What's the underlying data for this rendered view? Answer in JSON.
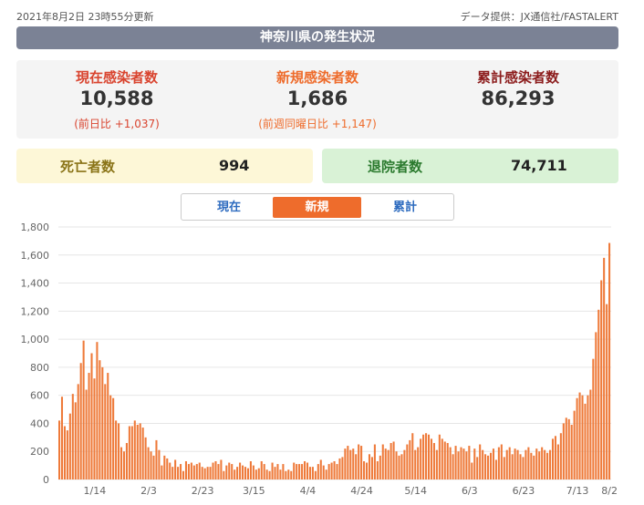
{
  "header": {
    "updated": "2021年8月2日 23時55分更新",
    "source": "データ提供：JX通信社/FASTALERT"
  },
  "region_title": "神奈川県の発生状況",
  "stats": {
    "current": {
      "label": "現在感染者数",
      "value": "10,588",
      "sub": "(前日比 +1,037)"
    },
    "new": {
      "label": "新規感染者数",
      "value": "1,686",
      "sub": "(前週同曜日比 +1,147)"
    },
    "total": {
      "label": "累計感染者数",
      "value": "86,293"
    }
  },
  "deaths": {
    "label": "死亡者数",
    "value": "994"
  },
  "discharged": {
    "label": "退院者数",
    "value": "74,711"
  },
  "tabs": [
    {
      "label": "現在",
      "active": false
    },
    {
      "label": "新規",
      "active": true
    },
    {
      "label": "累計",
      "active": false
    }
  ],
  "colors": {
    "bar": "#ee7a3a",
    "accent": "#ee6c2c",
    "header_bar": "#7b8295"
  },
  "chart_data": {
    "type": "bar",
    "ylim": [
      0,
      1800
    ],
    "yticks": [
      0,
      200,
      400,
      600,
      800,
      1000,
      1200,
      1400,
      1600,
      1800
    ],
    "ytick_labels": [
      "0",
      "200",
      "400",
      "600",
      "800",
      "1,000",
      "1,200",
      "1,400",
      "1,600",
      "1,800"
    ],
    "xtick_labels": [
      "1/14",
      "2/3",
      "2/23",
      "3/15",
      "4/4",
      "4/24",
      "5/14",
      "6/3",
      "6/23",
      "7/13",
      "8/2"
    ],
    "xtick_index": [
      13,
      33,
      53,
      72,
      92,
      112,
      132,
      152,
      172,
      192,
      212
    ],
    "grid": true,
    "series": [
      {
        "values": [
          420,
          590,
          380,
          350,
          470,
          610,
          550,
          680,
          830,
          990,
          640,
          760,
          900,
          720,
          980,
          850,
          800,
          680,
          760,
          600,
          580,
          420,
          400,
          230,
          200,
          260,
          380,
          380,
          420,
          390,
          400,
          370,
          300,
          230,
          200,
          170,
          280,
          210,
          100,
          170,
          150,
          120,
          90,
          140,
          90,
          110,
          60,
          130,
          110,
          120,
          100,
          110,
          120,
          90,
          80,
          90,
          90,
          120,
          130,
          110,
          140,
          60,
          100,
          120,
          110,
          70,
          90,
          120,
          100,
          90,
          80,
          130,
          100,
          70,
          80,
          130,
          110,
          70,
          60,
          120,
          90,
          110,
          70,
          110,
          60,
          70,
          60,
          120,
          110,
          110,
          110,
          130,
          120,
          90,
          90,
          60,
          110,
          140,
          100,
          70,
          110,
          120,
          130,
          110,
          150,
          160,
          220,
          240,
          210,
          220,
          180,
          250,
          240,
          130,
          120,
          180,
          160,
          250,
          130,
          170,
          250,
          220,
          210,
          260,
          270,
          200,
          170,
          180,
          210,
          250,
          280,
          330,
          210,
          230,
          290,
          320,
          330,
          320,
          290,
          260,
          210,
          320,
          290,
          270,
          260,
          230,
          180,
          240,
          200,
          230,
          220,
          200,
          240,
          120,
          220,
          160,
          250,
          210,
          180,
          170,
          190,
          220,
          140,
          230,
          250,
          160,
          210,
          230,
          180,
          220,
          210,
          180,
          160,
          210,
          230,
          190,
          170,
          220,
          200,
          230,
          210,
          190,
          210,
          290,
          310,
          250,
          330,
          400,
          440,
          430,
          390,
          490,
          580,
          620,
          600,
          540,
          600,
          640,
          860,
          1050,
          1210,
          1420,
          1580,
          1250,
          1686
        ]
      }
    ]
  }
}
